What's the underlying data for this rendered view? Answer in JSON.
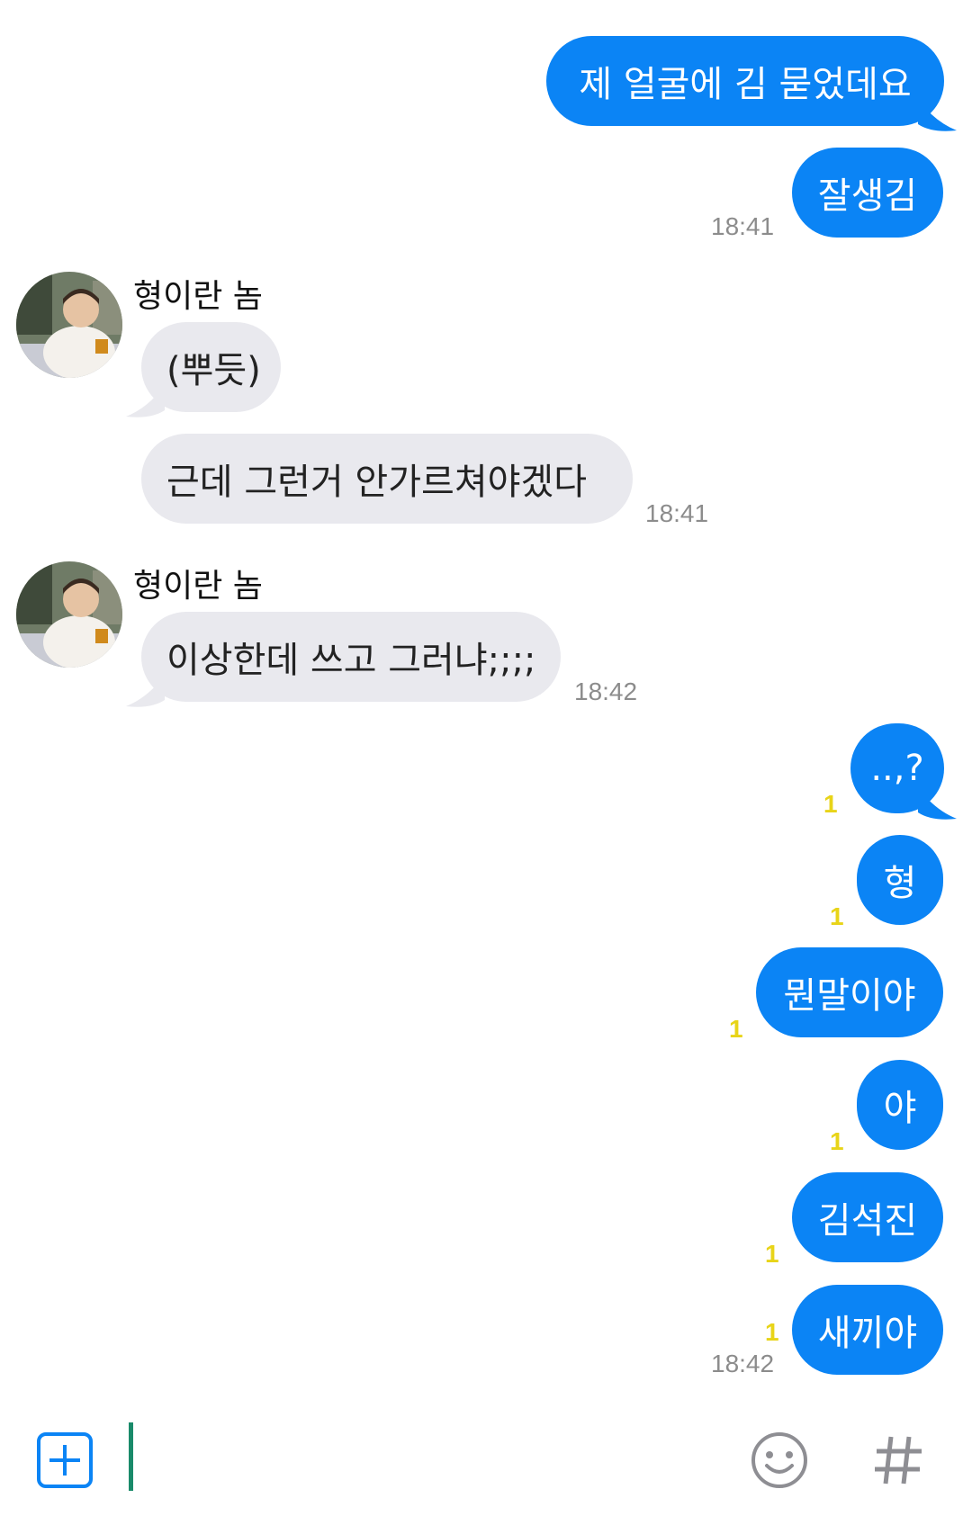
{
  "sender_name": "형이란 놈",
  "messages": {
    "m1": "제 얼굴에 김 묻었데요",
    "m2": "잘생김",
    "m2_time": "18:41",
    "r1": "(뿌듯)",
    "r2": "근데 그런거 안가르쳐야겠다",
    "r2_time": "18:41",
    "r3": "이상한데 쓰고 그러냐;;;;",
    "r3_time": "18:42",
    "o1": "..,?",
    "o2": "형",
    "o3": "뭔말이야",
    "o4": "야",
    "o5": "김석진",
    "o6": "새끼야",
    "o6_time": "18:42",
    "unread": "1"
  },
  "input": {
    "add_icon": "plus-square-icon",
    "emoji_icon": "smiley-icon",
    "hash_icon": "hash-icon"
  },
  "colors": {
    "outgoing": "#0b84f5",
    "incoming": "#e9e9ee",
    "unread": "#e8d418",
    "cursor": "#1a8a6a"
  }
}
